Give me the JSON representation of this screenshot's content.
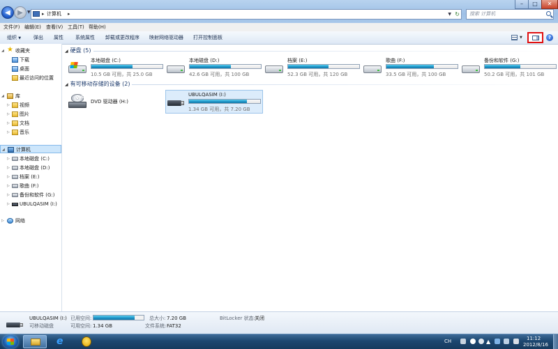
{
  "window": {
    "address_path": "计算机",
    "search_placeholder": "搜索 计算机",
    "controls": {
      "minimize": "–",
      "maximize": "□",
      "close": "✕"
    }
  },
  "menu": [
    "文件(F)",
    "编辑(E)",
    "查看(V)",
    "工具(T)",
    "帮助(H)"
  ],
  "commands": {
    "organize": "组织",
    "eject": "弹出",
    "properties": "属性",
    "system_properties": "系统属性",
    "uninstall": "卸载或更改程序",
    "map_drive": "映射网络驱动器",
    "control_panel": "打开控制面板",
    "help": "?"
  },
  "nav": {
    "favorites": {
      "label": "收藏夹",
      "items": [
        "下载",
        "桌面",
        "最近访问的位置"
      ]
    },
    "libraries": {
      "label": "库",
      "items": [
        "视频",
        "图片",
        "文档",
        "音乐"
      ]
    },
    "computer": {
      "label": "计算机",
      "items": [
        "本地磁盘 (C:)",
        "本地磁盘 (D:)",
        "档案 (E:)",
        "歌曲 (F:)",
        "备份和软件 (G:)",
        "UBULQASIM (I:)"
      ]
    },
    "network": {
      "label": "网络"
    }
  },
  "groups": {
    "hard_disks": {
      "label": "硬盘 (5)"
    },
    "removable": {
      "label": "有可移动存储的设备 (2)"
    }
  },
  "drives": [
    {
      "name": "本地磁盘 (C:)",
      "free": "10.5 GB 可用，共 25.0 GB",
      "used_fraction": 0.58,
      "icon": "windows-drive-icon"
    },
    {
      "name": "本地磁盘 (D:)",
      "free": "42.6 GB 可用，共 100 GB",
      "used_fraction": 0.574,
      "icon": "hard-drive-icon"
    },
    {
      "name": "档案 (E:)",
      "free": "52.3 GB 可用，共 120 GB",
      "used_fraction": 0.564,
      "icon": "hard-drive-icon"
    },
    {
      "name": "歌曲 (F:)",
      "free": "33.5 GB 可用，共 100 GB",
      "used_fraction": 0.665,
      "icon": "hard-drive-icon"
    },
    {
      "name": "备份和软件 (G:)",
      "free": "50.2 GB 可用，共 101 GB",
      "used_fraction": 0.503,
      "icon": "hard-drive-icon"
    }
  ],
  "removable": [
    {
      "name": "DVD 驱动器 (H:)",
      "icon": "dvd-drive-icon"
    },
    {
      "name": "UBULQASIM (I:)",
      "free": "1.34 GB 可用，共 7.20 GB",
      "used_fraction": 0.814,
      "icon": "usb-drive-icon"
    }
  ],
  "details": {
    "name": "UBULQASIM (I:)",
    "type": "可移动磁盘",
    "used_label": "已用空间:",
    "free_label": "可用空间:",
    "free_value": "1.34 GB",
    "used_fraction": 0.814,
    "total_label": "总大小:",
    "total_value": "7.20 GB",
    "fs_label": "文件系统:",
    "fs_value": "FAT32",
    "bitlocker_label": "BitLocker 状态:",
    "bitlocker_value": "关闭"
  },
  "taskbar": {
    "lang": "CH",
    "time": "11:12",
    "date": "2012/8/16"
  },
  "colors": {
    "highlight_box": "#e01010",
    "progress": "#1b8fc4",
    "selection": "#dcecfb"
  }
}
